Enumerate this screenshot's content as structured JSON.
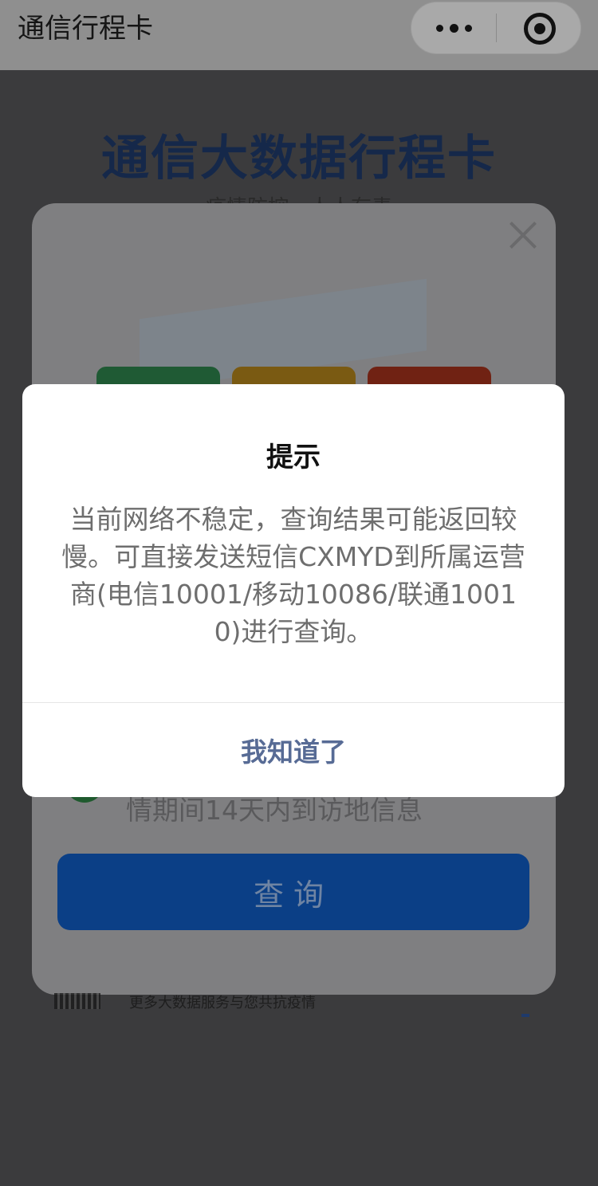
{
  "navbar": {
    "title": "通信行程卡",
    "more_icon": "more-dots-icon",
    "close_icon": "miniprogram-close-icon"
  },
  "background": {
    "heading": "通信大数据行程卡",
    "subheading": "疫情防控，人人有责",
    "card_close_icon": "close-icon",
    "consent_text": "情期间14天内到访地信息",
    "query_button": "查询",
    "footer_text": "更多大数据服务与您共抗疫情",
    "status_colors": {
      "green": "#1f5a34",
      "yellow": "#7a5a12",
      "red": "#702213"
    }
  },
  "dialog": {
    "title": "提示",
    "body": "当前网络不稳定，查询结果可能返回较慢。可直接发送短信CXMYD到所属运营商(电信10001/移动10086/联通10010)进行查询。",
    "confirm_label": "我知道了",
    "confirm_color": "#576b95"
  }
}
